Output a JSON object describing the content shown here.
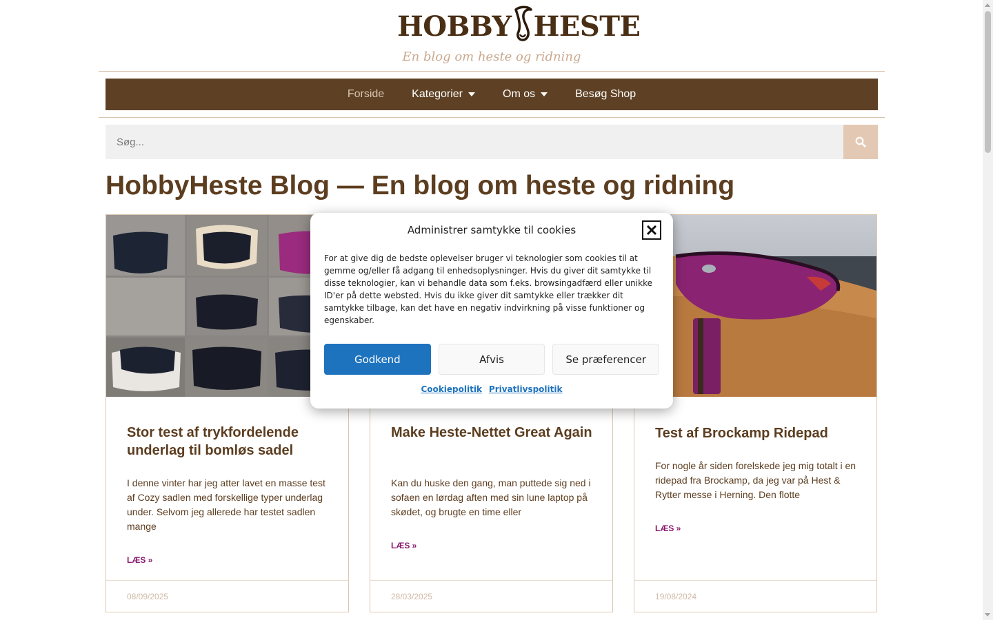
{
  "brand": {
    "logo_title_left": "HOBBY",
    "logo_title_right": "HESTE",
    "tagline": "En blog om heste og ridning"
  },
  "nav": {
    "items": [
      {
        "label": "Forside",
        "dropdown": false,
        "active": true
      },
      {
        "label": "Kategorier",
        "dropdown": true,
        "active": false
      },
      {
        "label": "Om os",
        "dropdown": true,
        "active": false
      },
      {
        "label": "Besøg Shop",
        "dropdown": false,
        "active": false
      }
    ]
  },
  "search": {
    "placeholder": "Søg...",
    "icon": "search-icon"
  },
  "page": {
    "title": "HobbyHeste Blog — En blog om heste og ridning"
  },
  "posts": [
    {
      "title": "Stor test af trykfordelende underlag til bomløs sadel",
      "excerpt": "I denne vinter har jeg atter lavet en masse test af Cozy sadlen med forskellige typer underlag under. Selvom jeg allerede har testet sadlen mange",
      "more": "LÆS »",
      "date": "08/09/2025"
    },
    {
      "title": "Make Heste-Nettet Great Again",
      "excerpt": "Kan du huske den gang, man puttede sig ned i sofaen en lørdag aften med sin lune laptop på skødet, og brugte en time eller",
      "more": "LÆS »",
      "date": "28/03/2025"
    },
    {
      "title": "Test af Brockamp Ridepad",
      "excerpt": "For nogle år siden forelskede jeg mig totalt i en ridepad fra Brockamp, da jeg var på Hest & Rytter messe i Herning. Den flotte",
      "more": "LÆS »",
      "date": "19/08/2024"
    }
  ],
  "cookie_modal": {
    "title": "Administrer samtykke til cookies",
    "text": "For at give dig de bedste oplevelser bruger vi teknologier som cookies til at gemme og/eller få adgang til enhedsoplysninger. Hvis du giver dit samtykke til disse teknologier, kan vi behandle data som f.eks. browsingadfærd eller unikke ID'er på dette websted. Hvis du ikke giver dit samtykke eller trækker dit samtykke tilbage, kan det have en negativ indvirkning på visse funktioner og egenskaber.",
    "accept_label": "Godkend",
    "deny_label": "Afvis",
    "prefs_label": "Se præferencer",
    "link_cookie": "Cookiepolitik",
    "link_privacy": "Privatlivspolitik"
  },
  "colors": {
    "brand_brown": "#5e4124",
    "text_brown": "#5c3d1f",
    "accent_tan": "#e3c9b4",
    "link_purple": "#8a1a6e",
    "modal_blue": "#1e73be"
  }
}
